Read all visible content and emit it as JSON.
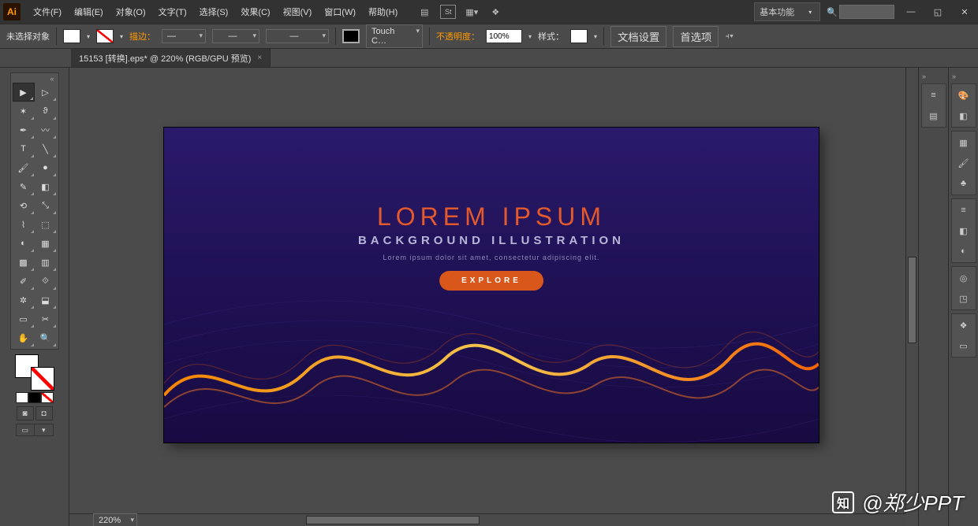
{
  "app": {
    "logo": "Ai"
  },
  "menu": [
    "文件(F)",
    "编辑(E)",
    "对象(O)",
    "文字(T)",
    "选择(S)",
    "效果(C)",
    "视图(V)",
    "窗口(W)",
    "帮助(H)"
  ],
  "workspace": "基本功能",
  "ctrl": {
    "no_selection": "未选择对象",
    "stroke_label": "描边：",
    "stroke_dash": "—",
    "touch": "Touch C…",
    "opacity_label": "不透明度：",
    "opacity_val": "100%",
    "style_label": "样式：",
    "doc_setup": "文档设置",
    "prefs": "首选项"
  },
  "doc_tab": {
    "title": "15153 [转换].eps* @ 220% (RGB/GPU 预览)",
    "close": "×"
  },
  "tools": {
    "names": [
      "selection-tool",
      "direct-selection-tool",
      "magic-wand-tool",
      "lasso-tool",
      "pen-tool",
      "curvature-tool",
      "type-tool",
      "line-segment-tool",
      "brush-tool",
      "blob-brush-tool",
      "pencil-tool",
      "eraser-tool",
      "rotate-tool",
      "scale-tool",
      "width-tool",
      "free-transform-tool",
      "shape-builder-tool",
      "perspective-grid-tool",
      "mesh-tool",
      "gradient-tool",
      "eyedropper-tool",
      "blend-tool",
      "symbol-sprayer-tool",
      "column-graph-tool",
      "artboard-tool",
      "slice-tool",
      "hand-tool",
      "zoom-tool"
    ],
    "glyphs": [
      "▶",
      "▷",
      "✶",
      "ϑ",
      "✒",
      "〰",
      "T",
      "╲",
      "🖌",
      "●",
      "✎",
      "◧",
      "⟲",
      "⤡",
      "⌇",
      "⬚",
      "◐",
      "▦",
      "▩",
      "▥",
      "✐",
      "⟐",
      "✲",
      "⬓",
      "▭",
      "✂",
      "✋",
      "🔍"
    ]
  },
  "artwork": {
    "title": "LOREM IPSUM",
    "subtitle": "BACKGROUND ILLUSTRATION",
    "body": "Lorem ipsum dolor sit amet, consectetur  adipiscing elit.",
    "button": "EXPLORE"
  },
  "right_panels_a": [
    "properties-icon",
    "layers-icon"
  ],
  "right_panels_b": [
    "color-icon",
    "swatches-icon",
    "brushes-icon",
    "symbols-icon",
    "stroke-icon",
    "gradient-icon",
    "transparency-icon",
    "appearance-icon",
    "graphic-styles-icon",
    "align-icon",
    "transform-icon",
    "libraries-icon"
  ],
  "watermark": {
    "logo": "知",
    "text": "@郑少PPT"
  },
  "status_zoom": "220%"
}
